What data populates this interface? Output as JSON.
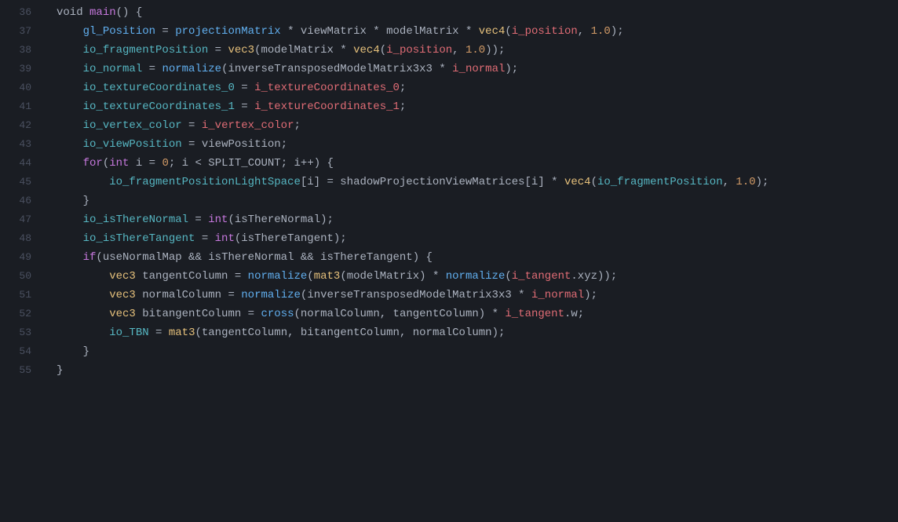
{
  "code": {
    "lines": [
      {
        "num": 36,
        "tokens": [
          {
            "t": "plain",
            "v": "void "
          },
          {
            "t": "kw",
            "v": "main"
          },
          {
            "t": "plain",
            "v": "() {"
          }
        ]
      },
      {
        "num": 37,
        "tokens": [
          {
            "t": "plain",
            "v": "    "
          },
          {
            "t": "glvar",
            "v": "gl_Position"
          },
          {
            "t": "plain",
            "v": " = "
          },
          {
            "t": "func",
            "v": "projectionMatrix"
          },
          {
            "t": "plain",
            "v": " * "
          },
          {
            "t": "plain",
            "v": "viewMatrix"
          },
          {
            "t": "plain",
            "v": " * "
          },
          {
            "t": "plain",
            "v": "modelMatrix"
          },
          {
            "t": "plain",
            "v": " * "
          },
          {
            "t": "type",
            "v": "vec4"
          },
          {
            "t": "plain",
            "v": "("
          },
          {
            "t": "ivar",
            "v": "i_position"
          },
          {
            "t": "plain",
            "v": ", "
          },
          {
            "t": "num",
            "v": "1.0"
          },
          {
            "t": "plain",
            "v": ");"
          }
        ]
      },
      {
        "num": 38,
        "tokens": [
          {
            "t": "plain",
            "v": "    "
          },
          {
            "t": "iovar",
            "v": "io_fragmentPosition"
          },
          {
            "t": "plain",
            "v": " = "
          },
          {
            "t": "type",
            "v": "vec3"
          },
          {
            "t": "plain",
            "v": "("
          },
          {
            "t": "plain",
            "v": "modelMatrix"
          },
          {
            "t": "plain",
            "v": " * "
          },
          {
            "t": "type",
            "v": "vec4"
          },
          {
            "t": "plain",
            "v": "("
          },
          {
            "t": "ivar",
            "v": "i_position"
          },
          {
            "t": "plain",
            "v": ", "
          },
          {
            "t": "num",
            "v": "1.0"
          },
          {
            "t": "plain",
            "v": "));"
          }
        ]
      },
      {
        "num": 39,
        "tokens": [
          {
            "t": "plain",
            "v": "    "
          },
          {
            "t": "iovar",
            "v": "io_normal"
          },
          {
            "t": "plain",
            "v": " = "
          },
          {
            "t": "func",
            "v": "normalize"
          },
          {
            "t": "plain",
            "v": "("
          },
          {
            "t": "plain",
            "v": "inverseTransposedModelMatrix3x3"
          },
          {
            "t": "plain",
            "v": " * "
          },
          {
            "t": "ivar",
            "v": "i_normal"
          },
          {
            "t": "plain",
            "v": ");"
          }
        ]
      },
      {
        "num": 40,
        "tokens": [
          {
            "t": "plain",
            "v": "    "
          },
          {
            "t": "iovar",
            "v": "io_textureCoordinates_0"
          },
          {
            "t": "plain",
            "v": " = "
          },
          {
            "t": "ivar",
            "v": "i_textureCoordinates_0"
          },
          {
            "t": "plain",
            "v": ";"
          }
        ]
      },
      {
        "num": 41,
        "tokens": [
          {
            "t": "plain",
            "v": "    "
          },
          {
            "t": "iovar",
            "v": "io_textureCoordinates_1"
          },
          {
            "t": "plain",
            "v": " = "
          },
          {
            "t": "ivar",
            "v": "i_textureCoordinates_1"
          },
          {
            "t": "plain",
            "v": ";"
          }
        ]
      },
      {
        "num": 42,
        "tokens": [
          {
            "t": "plain",
            "v": "    "
          },
          {
            "t": "iovar",
            "v": "io_vertex_color"
          },
          {
            "t": "plain",
            "v": " = "
          },
          {
            "t": "ivar",
            "v": "i_vertex_color"
          },
          {
            "t": "plain",
            "v": ";"
          }
        ]
      },
      {
        "num": 43,
        "tokens": [
          {
            "t": "plain",
            "v": "    "
          },
          {
            "t": "iovar",
            "v": "io_viewPosition"
          },
          {
            "t": "plain",
            "v": " = "
          },
          {
            "t": "plain",
            "v": "viewPosition"
          },
          {
            "t": "plain",
            "v": ";"
          }
        ]
      },
      {
        "num": 44,
        "tokens": [
          {
            "t": "plain",
            "v": "    "
          },
          {
            "t": "kw",
            "v": "for"
          },
          {
            "t": "plain",
            "v": "("
          },
          {
            "t": "kw",
            "v": "int"
          },
          {
            "t": "plain",
            "v": " i = "
          },
          {
            "t": "num",
            "v": "0"
          },
          {
            "t": "plain",
            "v": "; i < "
          },
          {
            "t": "plain",
            "v": "SPLIT_COUNT"
          },
          {
            "t": "plain",
            "v": "; i++) {"
          }
        ]
      },
      {
        "num": 45,
        "tokens": [
          {
            "t": "plain",
            "v": "        "
          },
          {
            "t": "iovar",
            "v": "io_fragmentPositionLightSpace"
          },
          {
            "t": "plain",
            "v": "[i] = "
          },
          {
            "t": "plain",
            "v": "shadowProjectionViewMatrices"
          },
          {
            "t": "plain",
            "v": "[i] * "
          },
          {
            "t": "type",
            "v": "vec4"
          },
          {
            "t": "plain",
            "v": "("
          },
          {
            "t": "iovar",
            "v": "io_fragmentPosition"
          },
          {
            "t": "plain",
            "v": ", "
          },
          {
            "t": "num",
            "v": "1.0"
          },
          {
            "t": "plain",
            "v": ");"
          }
        ]
      },
      {
        "num": 46,
        "tokens": [
          {
            "t": "plain",
            "v": "    }"
          }
        ]
      },
      {
        "num": 47,
        "tokens": [
          {
            "t": "plain",
            "v": "    "
          },
          {
            "t": "iovar",
            "v": "io_isThereNormal"
          },
          {
            "t": "plain",
            "v": " = "
          },
          {
            "t": "kw",
            "v": "int"
          },
          {
            "t": "plain",
            "v": "("
          },
          {
            "t": "plain",
            "v": "isThereNormal"
          },
          {
            "t": "plain",
            "v": ");"
          }
        ]
      },
      {
        "num": 48,
        "tokens": [
          {
            "t": "plain",
            "v": "    "
          },
          {
            "t": "iovar",
            "v": "io_isThereTangent"
          },
          {
            "t": "plain",
            "v": " = "
          },
          {
            "t": "kw",
            "v": "int"
          },
          {
            "t": "plain",
            "v": "("
          },
          {
            "t": "plain",
            "v": "isThereTangent"
          },
          {
            "t": "plain",
            "v": ");"
          }
        ]
      },
      {
        "num": 49,
        "tokens": [
          {
            "t": "plain",
            "v": "    "
          },
          {
            "t": "kw",
            "v": "if"
          },
          {
            "t": "plain",
            "v": "("
          },
          {
            "t": "plain",
            "v": "useNormalMap"
          },
          {
            "t": "plain",
            "v": " && "
          },
          {
            "t": "plain",
            "v": "isThereNormal"
          },
          {
            "t": "plain",
            "v": " && "
          },
          {
            "t": "plain",
            "v": "isThereTangent"
          },
          {
            "t": "plain",
            "v": ") {"
          }
        ]
      },
      {
        "num": 50,
        "tokens": [
          {
            "t": "plain",
            "v": "        "
          },
          {
            "t": "type",
            "v": "vec3"
          },
          {
            "t": "plain",
            "v": " "
          },
          {
            "t": "plain",
            "v": "tangentColumn"
          },
          {
            "t": "plain",
            "v": " = "
          },
          {
            "t": "func",
            "v": "normalize"
          },
          {
            "t": "plain",
            "v": "("
          },
          {
            "t": "type",
            "v": "mat3"
          },
          {
            "t": "plain",
            "v": "("
          },
          {
            "t": "plain",
            "v": "modelMatrix"
          },
          {
            "t": "plain",
            "v": ") * "
          },
          {
            "t": "func",
            "v": "normalize"
          },
          {
            "t": "plain",
            "v": "("
          },
          {
            "t": "ivar",
            "v": "i_tangent"
          },
          {
            "t": "plain",
            "v": ".xyz));"
          }
        ]
      },
      {
        "num": 51,
        "tokens": [
          {
            "t": "plain",
            "v": "        "
          },
          {
            "t": "type",
            "v": "vec3"
          },
          {
            "t": "plain",
            "v": " "
          },
          {
            "t": "plain",
            "v": "normalColumn"
          },
          {
            "t": "plain",
            "v": " = "
          },
          {
            "t": "func",
            "v": "normalize"
          },
          {
            "t": "plain",
            "v": "("
          },
          {
            "t": "plain",
            "v": "inverseTransposedModelMatrix3x3"
          },
          {
            "t": "plain",
            "v": " * "
          },
          {
            "t": "ivar",
            "v": "i_normal"
          },
          {
            "t": "plain",
            "v": ");"
          }
        ]
      },
      {
        "num": 52,
        "tokens": [
          {
            "t": "plain",
            "v": "        "
          },
          {
            "t": "type",
            "v": "vec3"
          },
          {
            "t": "plain",
            "v": " "
          },
          {
            "t": "plain",
            "v": "bitangentColumn"
          },
          {
            "t": "plain",
            "v": " = "
          },
          {
            "t": "func",
            "v": "cross"
          },
          {
            "t": "plain",
            "v": "("
          },
          {
            "t": "plain",
            "v": "normalColumn"
          },
          {
            "t": "plain",
            "v": ", "
          },
          {
            "t": "plain",
            "v": "tangentColumn"
          },
          {
            "t": "plain",
            "v": ") * "
          },
          {
            "t": "ivar",
            "v": "i_tangent"
          },
          {
            "t": "plain",
            "v": ".w;"
          }
        ]
      },
      {
        "num": 53,
        "tokens": [
          {
            "t": "plain",
            "v": "        "
          },
          {
            "t": "iovar",
            "v": "io_TBN"
          },
          {
            "t": "plain",
            "v": " = "
          },
          {
            "t": "type",
            "v": "mat3"
          },
          {
            "t": "plain",
            "v": "("
          },
          {
            "t": "plain",
            "v": "tangentColumn"
          },
          {
            "t": "plain",
            "v": ", "
          },
          {
            "t": "plain",
            "v": "bitangentColumn"
          },
          {
            "t": "plain",
            "v": ", "
          },
          {
            "t": "plain",
            "v": "normalColumn"
          },
          {
            "t": "plain",
            "v": ");"
          }
        ]
      },
      {
        "num": 54,
        "tokens": [
          {
            "t": "plain",
            "v": "    }"
          }
        ]
      },
      {
        "num": 55,
        "tokens": [
          {
            "t": "plain",
            "v": "}"
          }
        ]
      }
    ]
  }
}
